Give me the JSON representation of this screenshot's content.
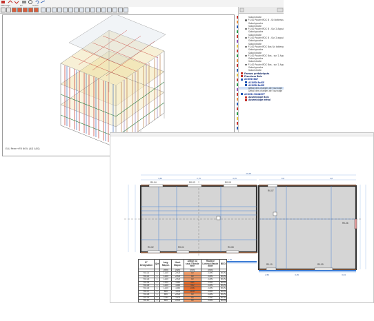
{
  "ribbon": {
    "groups": [
      "Affichage",
      "Fin",
      "Outils"
    ],
    "colors": {
      "accent_red": "#c4322b",
      "accent_blue": "#2358b5",
      "selection": "#cfe0f7"
    }
  },
  "viewport": {
    "status_text": "ELU Perm+FR 60% (4D ASS)"
  },
  "tree": {
    "items": [
      {
        "label": "Sabot droite",
        "level": 2,
        "style": "normal"
      },
      {
        "label": "P1-00 Poutre RDC B - Sci bdtenpur 1",
        "level": 1,
        "style": "node"
      },
      {
        "label": "Sabot gauche",
        "level": 2,
        "style": "normal"
      },
      {
        "label": "Sabot droite",
        "level": 2,
        "style": "normal"
      },
      {
        "label": "P1-00 Poutre RDC B - Sur 2 Appuis",
        "level": 1,
        "style": "node"
      },
      {
        "label": "Sabot gauche",
        "level": 2,
        "style": "normal"
      },
      {
        "label": "Sabot droite",
        "level": 2,
        "style": "normal"
      },
      {
        "label": "P1-00 Poutre RDC B - Sur 2 appuis",
        "level": 1,
        "style": "node"
      },
      {
        "label": "Sabot gauche",
        "level": 2,
        "style": "normal"
      },
      {
        "label": "Sabot droite",
        "level": 2,
        "style": "normal"
      },
      {
        "label": "P1-00 Poutre RDC Bas Sci bdtenpur",
        "level": 1,
        "style": "node"
      },
      {
        "label": "Sabot gauche",
        "level": 2,
        "style": "normal"
      },
      {
        "label": "Sabot droite",
        "level": 2,
        "style": "normal"
      },
      {
        "label": "P1-00 Poutre RDC Bas - sur 2 Appuis",
        "level": 1,
        "style": "node"
      },
      {
        "label": "Sabot gauche",
        "level": 2,
        "style": "normal"
      },
      {
        "label": "Sabot droite",
        "level": 2,
        "style": "normal"
      },
      {
        "label": "P1-00 Poutre RDC Bas - sur 2 Appuis",
        "level": 1,
        "style": "node"
      },
      {
        "label": "Sabot gauche",
        "level": 2,
        "style": "normal"
      },
      {
        "label": "Sabot droite",
        "level": 2,
        "style": "normal"
      },
      {
        "label": "Fermes préfabriqués",
        "level": 0,
        "style": "bold"
      },
      {
        "label": "Planchers Bois",
        "level": 0,
        "style": "bold"
      },
      {
        "label": "ACORD BAT",
        "level": 0,
        "style": "brand"
      },
      {
        "label": "ACORD BoiSE",
        "level": 1,
        "style": "brand"
      },
      {
        "label": "ACORD BoiSE",
        "level": 1,
        "style": "brand"
      },
      {
        "label": "Détail des charges de l'ouvrage",
        "level": 2,
        "style": "selected"
      },
      {
        "label": "Détail des charges de l'ouvrage",
        "level": 2,
        "style": "normal"
      },
      {
        "label": "ACORD CONNECT",
        "level": 0,
        "style": "brand"
      },
      {
        "label": "Assemblage Bois",
        "level": 1,
        "style": "bold"
      },
      {
        "label": "Assemblage métal",
        "level": 1,
        "style": "bold"
      }
    ]
  },
  "plan": {
    "wall_labels": [
      "R0-04",
      "R0-03",
      "R0-05",
      "R0-07",
      "R0-06",
      "R0-02",
      "R0-01",
      "R0-08",
      "R0-10",
      "R0-09"
    ],
    "dims_top": [
      "3,85",
      "2,75",
      "3,25",
      "8,8",
      "4,8"
    ],
    "dims_bottom": [
      "3,24",
      "4,25",
      "3,25",
      "4,00",
      "1,70",
      "2,50",
      "3,25",
      "3,04"
    ],
    "overall_width": "14,38"
  },
  "opening_table": {
    "headers": [
      "N° Désignation",
      "Qté",
      "Larg. Maçon.",
      "Haut. Maçon.",
      "Allège ou seuil / Bande finie",
      "Hauteur Linteau/ Bande dalle",
      "BDO"
    ],
    "units": [
      "",
      "",
      "[mm]",
      "[mm]",
      "[mm]",
      "[mm]",
      ""
    ],
    "rows": [
      [
        "R0-01",
        "1",
        "1200",
        "2200",
        "50",
        "2390",
        "NON"
      ],
      [
        "R0-02",
        "1",
        "1200",
        "2200",
        "50",
        "2390",
        "NON"
      ],
      [
        "R0-03",
        "1",
        "1200",
        "2200",
        "50",
        "2390",
        "NON"
      ],
      [
        "R0-04",
        "1",
        "1200",
        "1350",
        "900",
        "2390",
        "NON"
      ],
      [
        "R0-05",
        "1",
        "1200",
        "1350",
        "900",
        "2390",
        "NON"
      ],
      [
        "R0-06",
        "1",
        "1200",
        "1350",
        "1050",
        "2390",
        "NON"
      ],
      [
        "R0-07",
        "1",
        "800",
        "1200",
        "1150",
        "2390",
        "NON"
      ],
      [
        "R0-08",
        "1",
        "800",
        "2200",
        "50",
        "2390",
        "NON"
      ],
      [
        "R0-09",
        "1",
        "2780",
        "2200",
        "50",
        "2390",
        "NON"
      ],
      [
        "R0-10",
        "1",
        "800",
        "2200",
        "50",
        "2390",
        "NON"
      ]
    ]
  }
}
